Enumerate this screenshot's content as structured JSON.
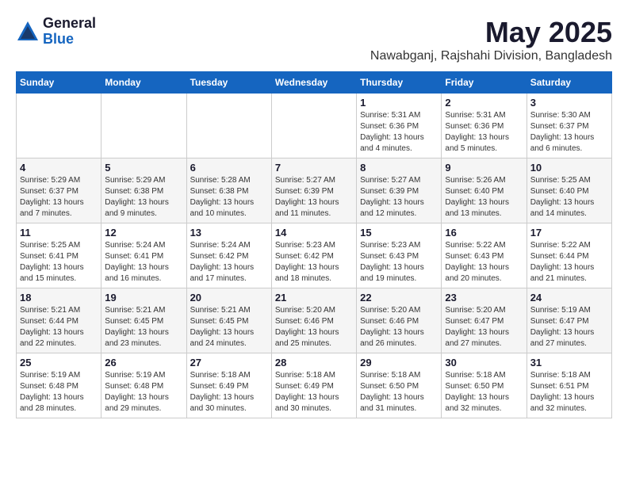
{
  "logo": {
    "general": "General",
    "blue": "Blue"
  },
  "title": {
    "month_year": "May 2025",
    "location": "Nawabganj, Rajshahi Division, Bangladesh"
  },
  "header": {
    "days": [
      "Sunday",
      "Monday",
      "Tuesday",
      "Wednesday",
      "Thursday",
      "Friday",
      "Saturday"
    ]
  },
  "weeks": [
    [
      {
        "day": "",
        "info": ""
      },
      {
        "day": "",
        "info": ""
      },
      {
        "day": "",
        "info": ""
      },
      {
        "day": "",
        "info": ""
      },
      {
        "day": "1",
        "info": "Sunrise: 5:31 AM\nSunset: 6:36 PM\nDaylight: 13 hours\nand 4 minutes."
      },
      {
        "day": "2",
        "info": "Sunrise: 5:31 AM\nSunset: 6:36 PM\nDaylight: 13 hours\nand 5 minutes."
      },
      {
        "day": "3",
        "info": "Sunrise: 5:30 AM\nSunset: 6:37 PM\nDaylight: 13 hours\nand 6 minutes."
      }
    ],
    [
      {
        "day": "4",
        "info": "Sunrise: 5:29 AM\nSunset: 6:37 PM\nDaylight: 13 hours\nand 7 minutes."
      },
      {
        "day": "5",
        "info": "Sunrise: 5:29 AM\nSunset: 6:38 PM\nDaylight: 13 hours\nand 9 minutes."
      },
      {
        "day": "6",
        "info": "Sunrise: 5:28 AM\nSunset: 6:38 PM\nDaylight: 13 hours\nand 10 minutes."
      },
      {
        "day": "7",
        "info": "Sunrise: 5:27 AM\nSunset: 6:39 PM\nDaylight: 13 hours\nand 11 minutes."
      },
      {
        "day": "8",
        "info": "Sunrise: 5:27 AM\nSunset: 6:39 PM\nDaylight: 13 hours\nand 12 minutes."
      },
      {
        "day": "9",
        "info": "Sunrise: 5:26 AM\nSunset: 6:40 PM\nDaylight: 13 hours\nand 13 minutes."
      },
      {
        "day": "10",
        "info": "Sunrise: 5:25 AM\nSunset: 6:40 PM\nDaylight: 13 hours\nand 14 minutes."
      }
    ],
    [
      {
        "day": "11",
        "info": "Sunrise: 5:25 AM\nSunset: 6:41 PM\nDaylight: 13 hours\nand 15 minutes."
      },
      {
        "day": "12",
        "info": "Sunrise: 5:24 AM\nSunset: 6:41 PM\nDaylight: 13 hours\nand 16 minutes."
      },
      {
        "day": "13",
        "info": "Sunrise: 5:24 AM\nSunset: 6:42 PM\nDaylight: 13 hours\nand 17 minutes."
      },
      {
        "day": "14",
        "info": "Sunrise: 5:23 AM\nSunset: 6:42 PM\nDaylight: 13 hours\nand 18 minutes."
      },
      {
        "day": "15",
        "info": "Sunrise: 5:23 AM\nSunset: 6:43 PM\nDaylight: 13 hours\nand 19 minutes."
      },
      {
        "day": "16",
        "info": "Sunrise: 5:22 AM\nSunset: 6:43 PM\nDaylight: 13 hours\nand 20 minutes."
      },
      {
        "day": "17",
        "info": "Sunrise: 5:22 AM\nSunset: 6:44 PM\nDaylight: 13 hours\nand 21 minutes."
      }
    ],
    [
      {
        "day": "18",
        "info": "Sunrise: 5:21 AM\nSunset: 6:44 PM\nDaylight: 13 hours\nand 22 minutes."
      },
      {
        "day": "19",
        "info": "Sunrise: 5:21 AM\nSunset: 6:45 PM\nDaylight: 13 hours\nand 23 minutes."
      },
      {
        "day": "20",
        "info": "Sunrise: 5:21 AM\nSunset: 6:45 PM\nDaylight: 13 hours\nand 24 minutes."
      },
      {
        "day": "21",
        "info": "Sunrise: 5:20 AM\nSunset: 6:46 PM\nDaylight: 13 hours\nand 25 minutes."
      },
      {
        "day": "22",
        "info": "Sunrise: 5:20 AM\nSunset: 6:46 PM\nDaylight: 13 hours\nand 26 minutes."
      },
      {
        "day": "23",
        "info": "Sunrise: 5:20 AM\nSunset: 6:47 PM\nDaylight: 13 hours\nand 27 minutes."
      },
      {
        "day": "24",
        "info": "Sunrise: 5:19 AM\nSunset: 6:47 PM\nDaylight: 13 hours\nand 27 minutes."
      }
    ],
    [
      {
        "day": "25",
        "info": "Sunrise: 5:19 AM\nSunset: 6:48 PM\nDaylight: 13 hours\nand 28 minutes."
      },
      {
        "day": "26",
        "info": "Sunrise: 5:19 AM\nSunset: 6:48 PM\nDaylight: 13 hours\nand 29 minutes."
      },
      {
        "day": "27",
        "info": "Sunrise: 5:18 AM\nSunset: 6:49 PM\nDaylight: 13 hours\nand 30 minutes."
      },
      {
        "day": "28",
        "info": "Sunrise: 5:18 AM\nSunset: 6:49 PM\nDaylight: 13 hours\nand 30 minutes."
      },
      {
        "day": "29",
        "info": "Sunrise: 5:18 AM\nSunset: 6:50 PM\nDaylight: 13 hours\nand 31 minutes."
      },
      {
        "day": "30",
        "info": "Sunrise: 5:18 AM\nSunset: 6:50 PM\nDaylight: 13 hours\nand 32 minutes."
      },
      {
        "day": "31",
        "info": "Sunrise: 5:18 AM\nSunset: 6:51 PM\nDaylight: 13 hours\nand 32 minutes."
      }
    ]
  ]
}
